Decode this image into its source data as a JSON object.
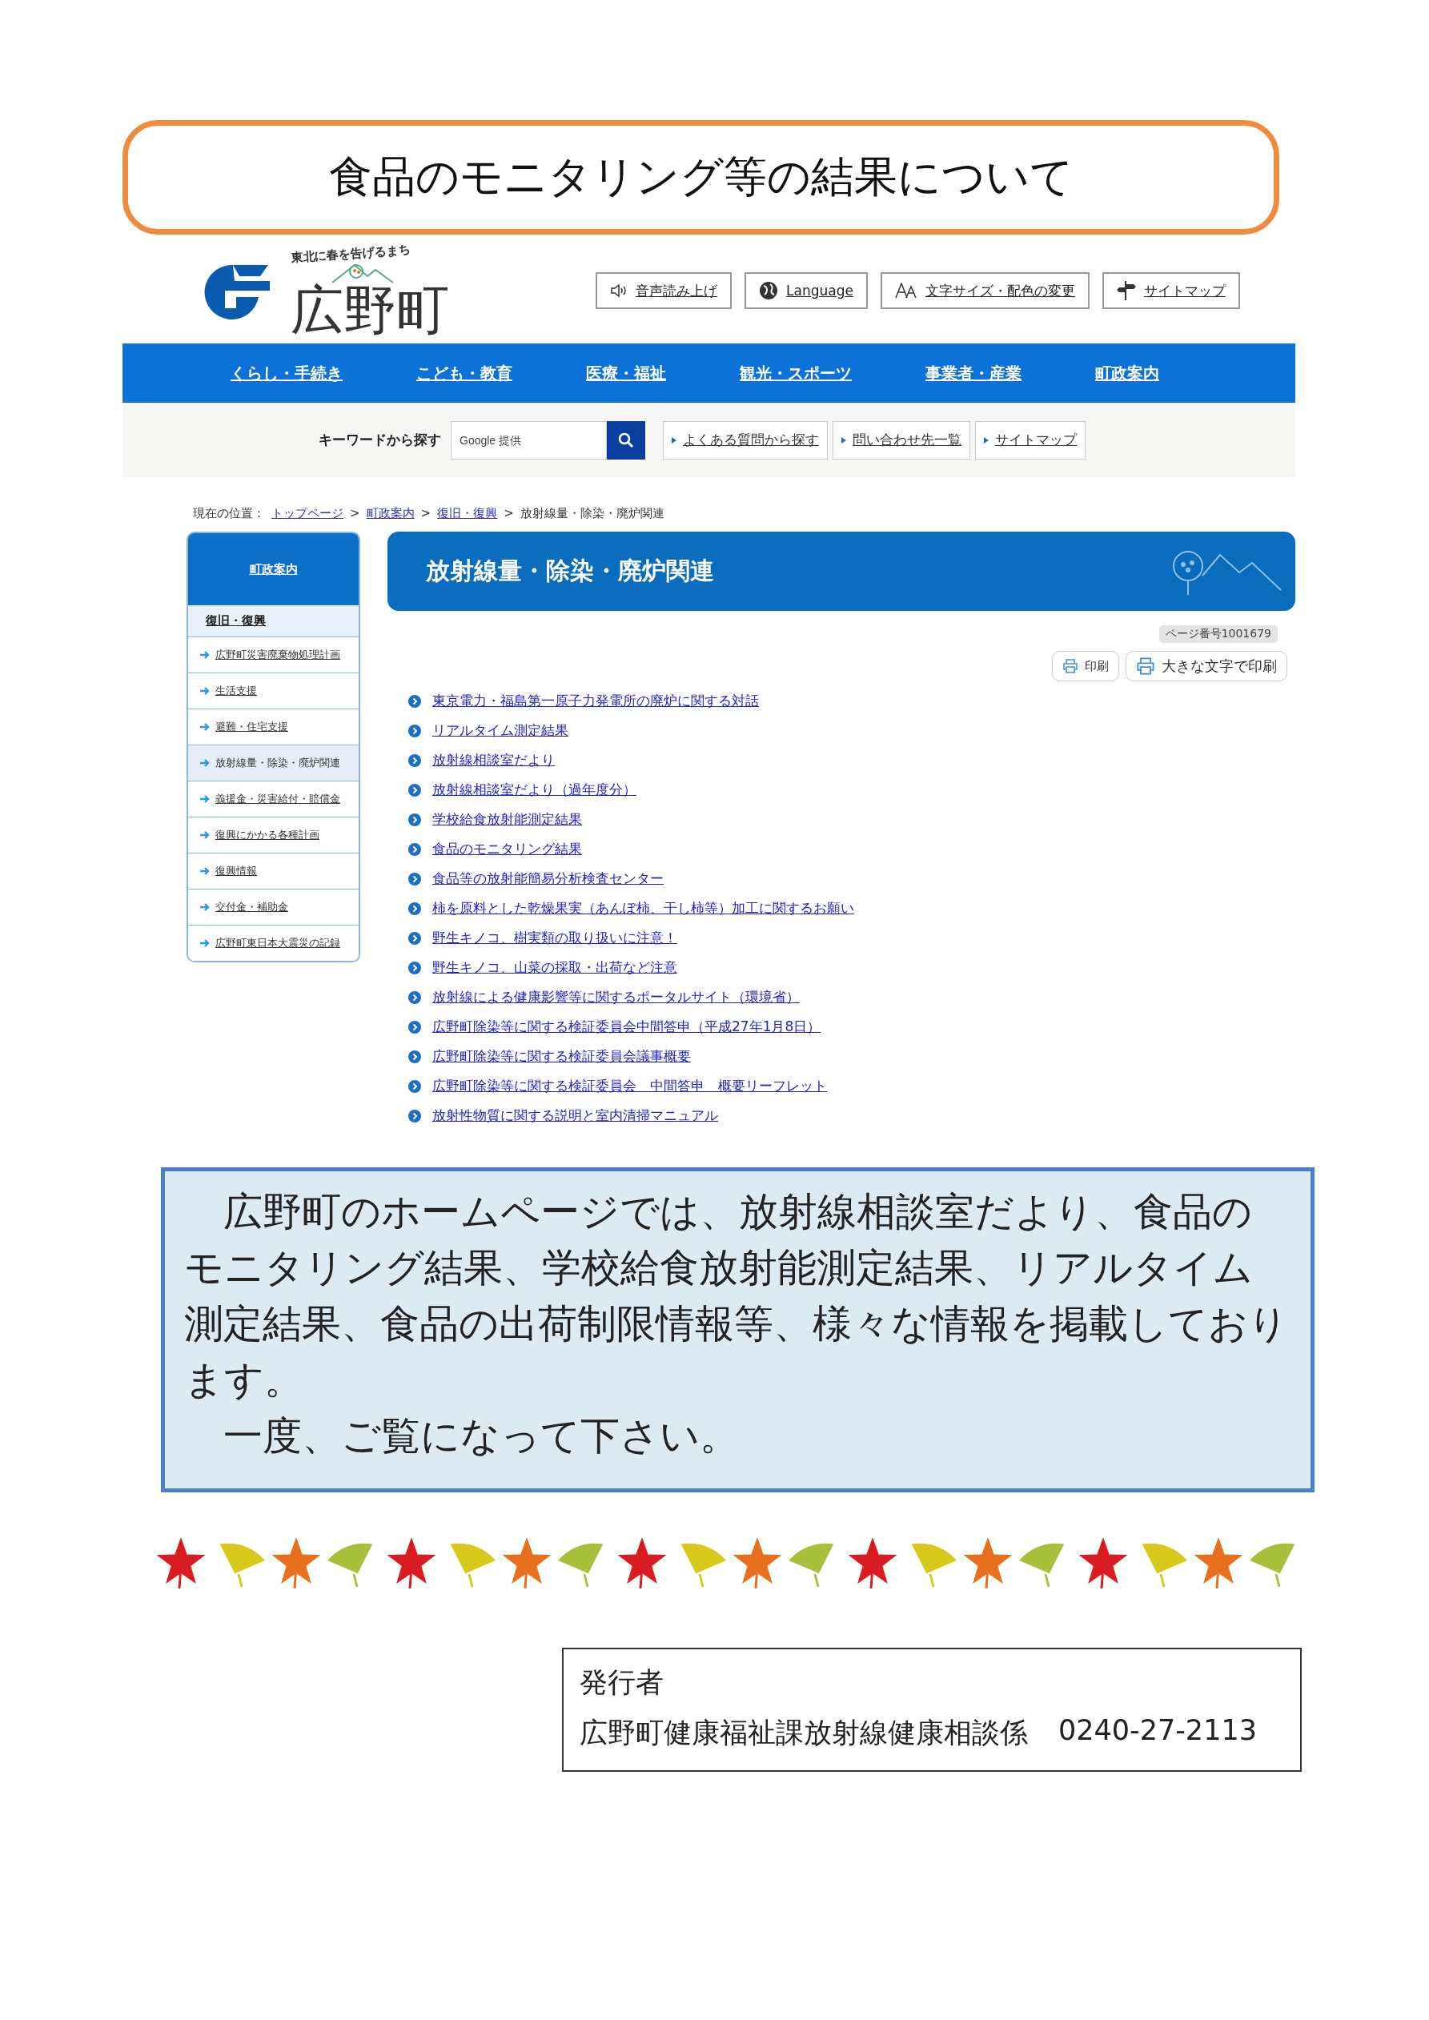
{
  "title": "食品のモニタリング等の結果について",
  "site": {
    "tagline": "東北に春を告げるまち",
    "town_name": "広野町",
    "utility_buttons": [
      {
        "kind": "speaker",
        "label": "音声読み上げ"
      },
      {
        "kind": "globe",
        "label": "Language"
      },
      {
        "kind": "font",
        "label": "文字サイズ・配色の変更"
      },
      {
        "kind": "signpost",
        "label": "サイトマップ"
      }
    ],
    "nav": [
      "くらし・手続き",
      "こども・教育",
      "医療・福祉",
      "観光・スポーツ",
      "事業者・産業",
      "町政案内"
    ],
    "search": {
      "label": "キーワードから探す",
      "placeholder": "Google 提供"
    },
    "quick_links": [
      "よくある質問から探す",
      "問い合わせ先一覧",
      "サイトマップ"
    ],
    "breadcrumb": {
      "label": "現在の位置：",
      "separator": ">",
      "links": [
        "トップページ",
        "町政案内",
        "復旧・復興"
      ],
      "current": "放射線量・除染・廃炉関連"
    },
    "sidebar": {
      "heading": "町政案内",
      "subheading": "復旧・復興",
      "items": [
        {
          "label": "広野町災害廃棄物処理計画",
          "selected": false
        },
        {
          "label": "生活支援",
          "selected": false
        },
        {
          "label": "避難・住宅支援",
          "selected": false
        },
        {
          "label": "放射線量・除染・廃炉関連",
          "selected": true
        },
        {
          "label": "義援金・災害給付・賠償金",
          "selected": false
        },
        {
          "label": "復興にかかる各種計画",
          "selected": false
        },
        {
          "label": "復興情報",
          "selected": false
        },
        {
          "label": "交付金・補助金",
          "selected": false
        },
        {
          "label": "広野町東日本大震災の記録",
          "selected": false
        }
      ]
    },
    "page_heading": "放射線量・除染・廃炉関連",
    "page_number": "ページ番号1001679",
    "print_buttons": [
      "印刷",
      "大きな文字で印刷"
    ],
    "links": [
      "東京電力・福島第一原子力発電所の廃炉に関する対話",
      "リアルタイム測定結果",
      "放射線相談室だより",
      "放射線相談室だより（過年度分）",
      "学校給食放射能測定結果",
      "食品のモニタリング結果",
      "食品等の放射能簡易分析検査センター",
      "柿を原料とした乾燥果実（あんぽ柿、干し柿等）加工に関するお願い",
      "野生キノコ、樹実類の取り扱いに注意！",
      "野生キノコ、山菜の採取・出荷など注意",
      "放射線による健康影響等に関するポータルサイト（環境省）",
      "広野町除染等に関する検証委員会中間答申（平成27年1月8日）",
      "広野町除染等に関する検証委員会議事概要",
      "広野町除染等に関する検証委員会　中間答申　概要リーフレット",
      "放射性物質に関する説明と室内清掃マニュアル"
    ]
  },
  "notice": [
    "広野町のホームページでは、放射線相談室だより、食品のモニタリング結果、学校給食放射能測定結果、リアルタイム測定結果、食品の出荷制限情報等、様々な情報を掲載しております。",
    "一度、ご覧になって下さい。"
  ],
  "publisher": {
    "label": "発行者",
    "department": "広野町健康福祉課放射線健康相談係",
    "phone": "0240-27-2113"
  }
}
